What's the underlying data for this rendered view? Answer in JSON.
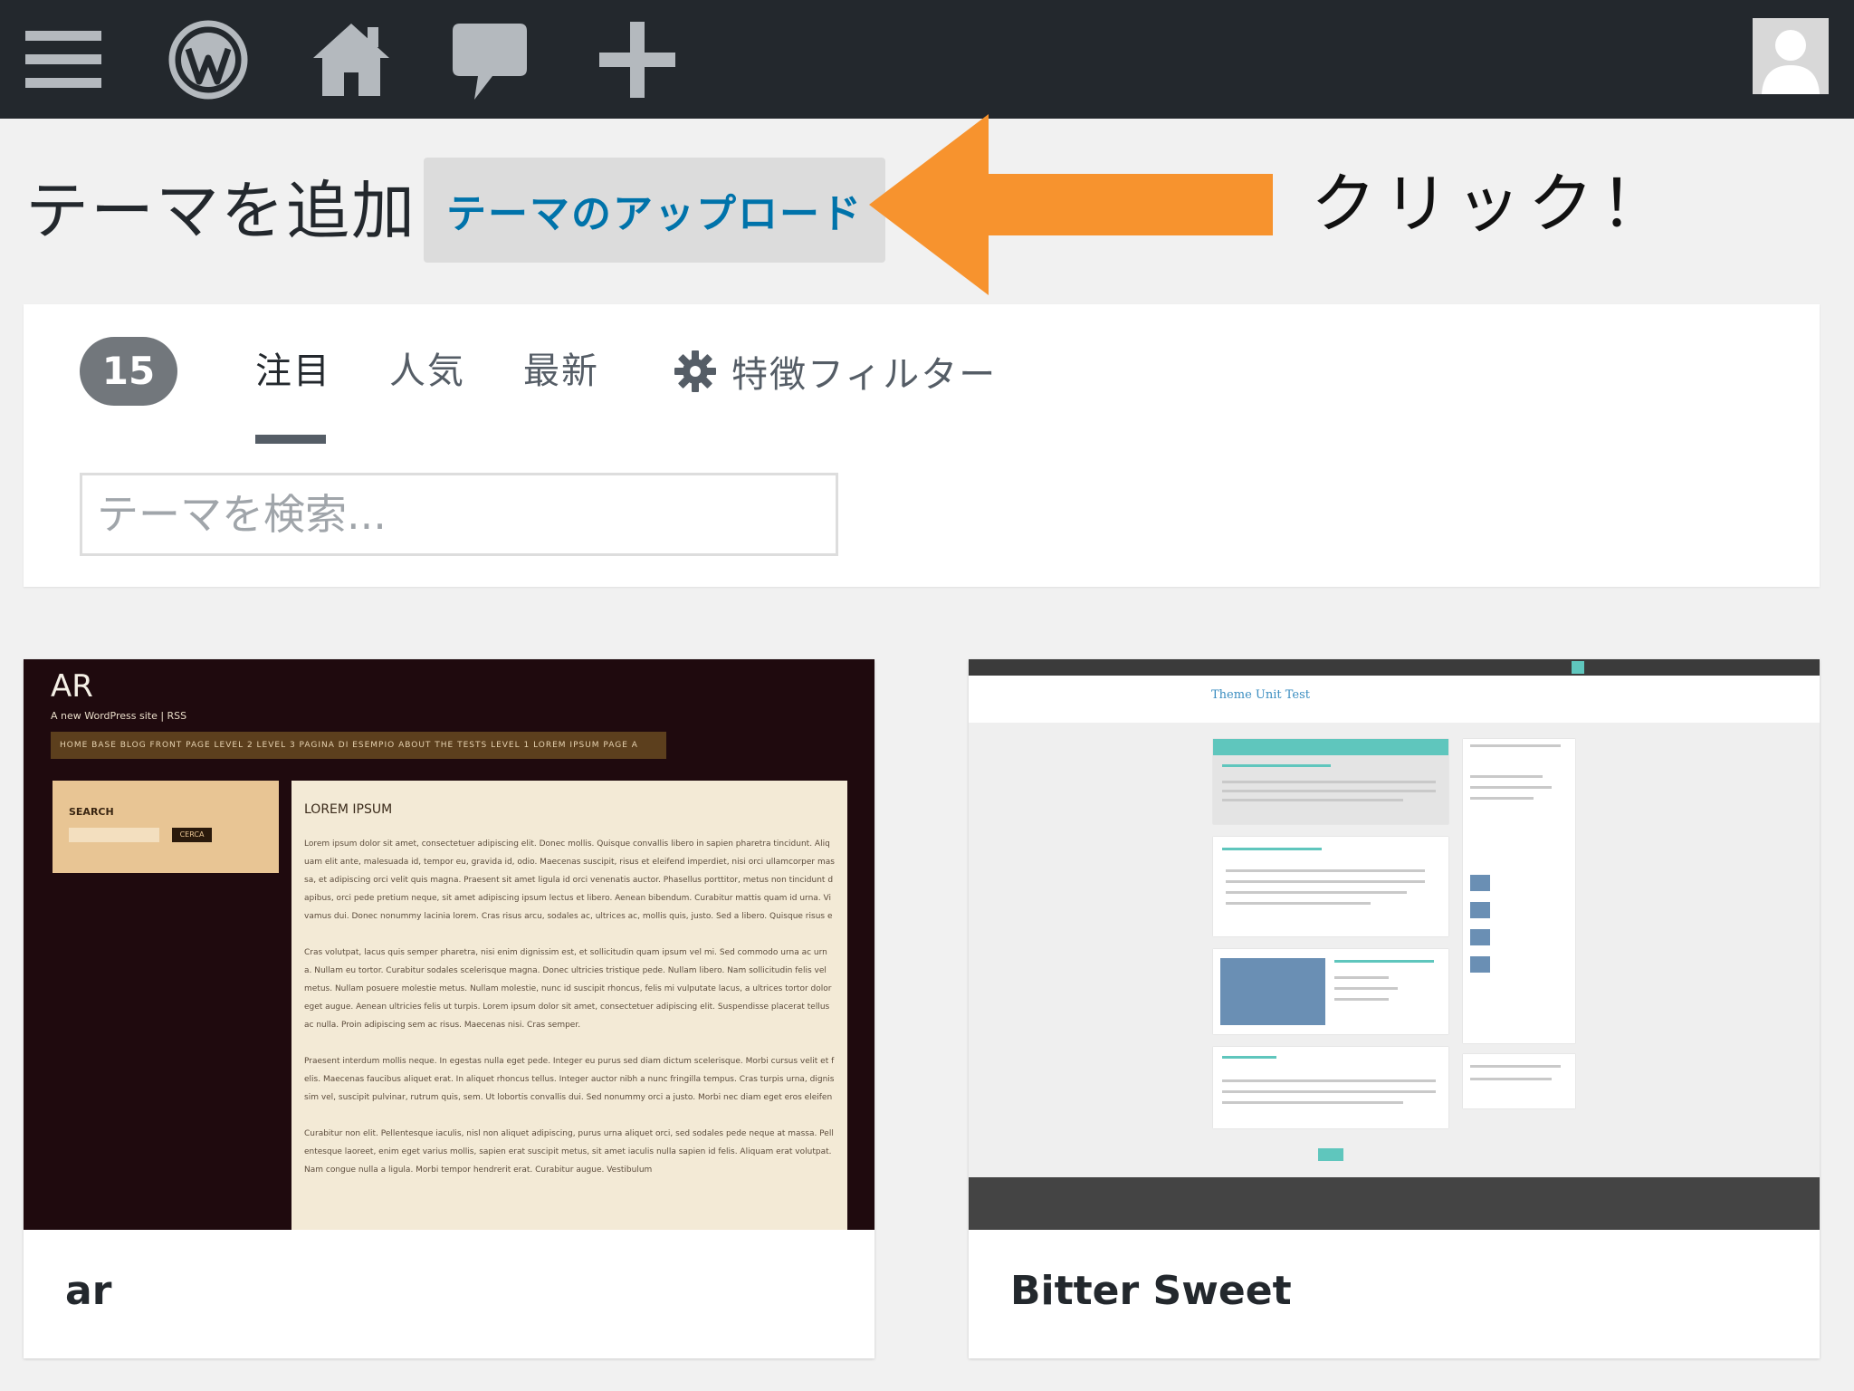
{
  "adminbar": {
    "icons": [
      "menu-icon",
      "wordpress-logo-icon",
      "home-icon",
      "comment-icon",
      "plus-icon",
      "user-avatar-icon"
    ]
  },
  "header": {
    "title": "テーマを追加",
    "upload_button": "テーマのアップロード",
    "annotation": "クリック！",
    "annotation_arrow_color": "#f7932e"
  },
  "filter": {
    "count": "15",
    "tabs": [
      "注目",
      "人気",
      "最新"
    ],
    "active_tab": "注目",
    "feature_filter": "特徴フィルター",
    "search_placeholder": "テーマを検索..."
  },
  "themes": [
    {
      "name": "ar",
      "preview": {
        "site_title": "AR",
        "tagline": "A new WordPress site | RSS",
        "nav": "HOME   BASE   BLOG   FRONT PAGE   LEVEL 2   LEVEL 3   PAGINA DI ESEMPIO   ABOUT THE TESTS   LEVEL 1   LOREM IPSUM   PAGE A",
        "search_label": "SEARCH",
        "search_button": "CERCA",
        "content_title": "LOREM IPSUM",
        "paragraphs": [
          "Lorem ipsum dolor sit amet, consectetuer adipiscing elit. Donec mollis. Quisque convallis libero in sapien pharetra tincidunt. Aliquam elit ante, malesuada id, tempor eu, gravida id, odio. Maecenas suscipit, risus et eleifend imperdiet, nisi orci ullamcorper massa, et adipiscing orci velit quis magna. Praesent sit amet ligula id orci venenatis auctor. Phasellus porttitor, metus non tincidunt dapibus, orci pede pretium neque, sit amet adipiscing ipsum lectus et libero. Aenean bibendum. Curabitur mattis quam id urna. Vivamus dui. Donec nonummy lacinia lorem. Cras risus arcu, sodales ac, ultrices ac, mollis quis, justo. Sed a libero. Quisque risus erat, posuere at, tristique non, lacinia quis, eros.",
          "Cras volutpat, lacus quis semper pharetra, nisi enim dignissim est, et sollicitudin quam ipsum vel mi. Sed commodo urna ac urna. Nullam eu tortor. Curabitur sodales scelerisque magna. Donec ultricies tristique pede. Nullam libero. Nam sollicitudin felis vel metus. Nullam posuere molestie metus. Nullam molestie, nunc id suscipit rhoncus, felis mi vulputate lacus, a ultrices tortor dolor eget augue. Aenean ultricies felis ut turpis. Lorem ipsum dolor sit amet, consectetuer adipiscing elit. Suspendisse placerat tellus ac nulla. Proin adipiscing sem ac risus. Maecenas nisi. Cras semper.",
          "Praesent interdum mollis neque. In egestas nulla eget pede. Integer eu purus sed diam dictum scelerisque. Morbi cursus velit et felis. Maecenas faucibus aliquet erat. In aliquet rhoncus tellus. Integer auctor nibh a nunc fringilla tempus. Cras turpis urna, dignissim vel, suscipit pulvinar, rutrum quis, sem. Ut lobortis convallis dui. Sed nonummy orci a justo. Morbi nec diam eget eros eleifend tincidunt.",
          "Curabitur non elit. Pellentesque iaculis, nisl non aliquet adipiscing, purus urna aliquet orci, sed sodales pede neque at massa. Pellentesque laoreet, enim eget varius mollis, sapien erat suscipit metus, sit amet iaculis nulla sapien id felis. Aliquam erat volutpat. Nam congue nulla a ligula. Morbi tempor hendrerit erat. Curabitur augue. Vestibulum"
        ]
      }
    },
    {
      "name": "Bitter Sweet",
      "preview": {
        "site_title": "Theme Unit Test",
        "accent": "#5fc6bd"
      }
    }
  ]
}
